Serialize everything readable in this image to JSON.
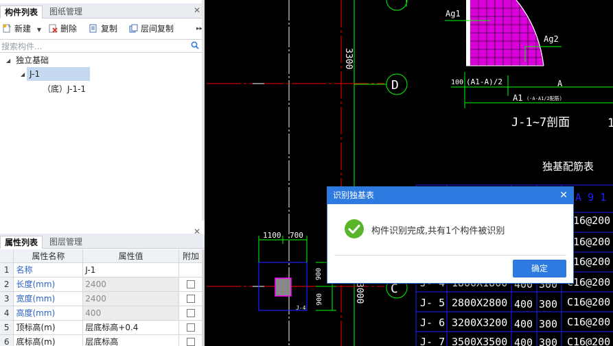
{
  "components_panel": {
    "tab_components": "构件列表",
    "tab_drawings": "图纸管理",
    "toolbar": {
      "new_label": "新建",
      "delete_label": "删除",
      "copy_label": "复制",
      "floor_copy_label": "层间复制"
    },
    "search_placeholder": "搜索构件...",
    "tree": {
      "root": "独立基础",
      "child": "J-1",
      "grandchild": "（底）J-1-1"
    }
  },
  "properties_panel": {
    "tab_properties": "属性列表",
    "tab_layers": "图层管理",
    "headers": {
      "name": "属性名称",
      "value": "属性值",
      "extra": "附加"
    },
    "rows": [
      {
        "index": "1",
        "name": "名称",
        "value": "J-1"
      },
      {
        "index": "2",
        "name": "长度(mm)",
        "value": "2400"
      },
      {
        "index": "3",
        "name": "宽度(mm)",
        "value": "2400"
      },
      {
        "index": "4",
        "name": "高度(mm)",
        "value": "400"
      },
      {
        "index": "5",
        "name": "顶标高(m)",
        "value": "层底标高+0.4"
      },
      {
        "index": "6",
        "name": "底标高(m)",
        "value": "层底标高"
      }
    ]
  },
  "cad": {
    "axis_d": "D",
    "axis_c": "C",
    "dim_3300": "3300",
    "dim_3000": "3000",
    "dim_1100": "1100",
    "dim_700": "700",
    "dim_900a": "900",
    "dim_900b": "900",
    "ag1": "Ag1",
    "ag2": "Ag2",
    "dim_100": "100",
    "a1_half": "(A1-A)/2",
    "a": "A",
    "a1_label": "A1",
    "a1_note": "(-A-A1/2配筋)",
    "section_title": "J-1~7剖面",
    "section_num": "1",
    "table_title": "独基配筋表",
    "col_header": "A 9 1",
    "j_label": "J-4",
    "table_rows": [
      {
        "name": "",
        "size": "",
        "h": "",
        "h2": "",
        "rebar": "C16@200"
      },
      {
        "name": "",
        "size": "",
        "h": "",
        "h2": "",
        "rebar": "C16@200"
      },
      {
        "name": "",
        "size": "",
        "h": "",
        "h2": "",
        "rebar": "C16@200"
      },
      {
        "name": "J- 4",
        "size": "1800X1800",
        "h": "400",
        "h2": "300",
        "rebar": "C16@200"
      },
      {
        "name": "J- 5",
        "size": "2800X2800",
        "h": "400",
        "h2": "300",
        "rebar": "C16@200"
      },
      {
        "name": "J- 6",
        "size": "3200X3200",
        "h": "400",
        "h2": "300",
        "rebar": "C16@200"
      },
      {
        "name": "J- 7",
        "size": "3500X3500",
        "h": "400",
        "h2": "300",
        "rebar": "C16@200"
      }
    ]
  },
  "dialog": {
    "title": "识别独基表",
    "message": "构件识别完成,共有1个构件被识别",
    "ok_label": "确定"
  },
  "colors": {
    "accent": "#2d7ae0",
    "cad_green": "#00ff00",
    "cad_red": "#ff0000",
    "cad_white": "#ffffff",
    "cad_magenta": "#ff00ff",
    "cad_blue": "#2020ff"
  }
}
